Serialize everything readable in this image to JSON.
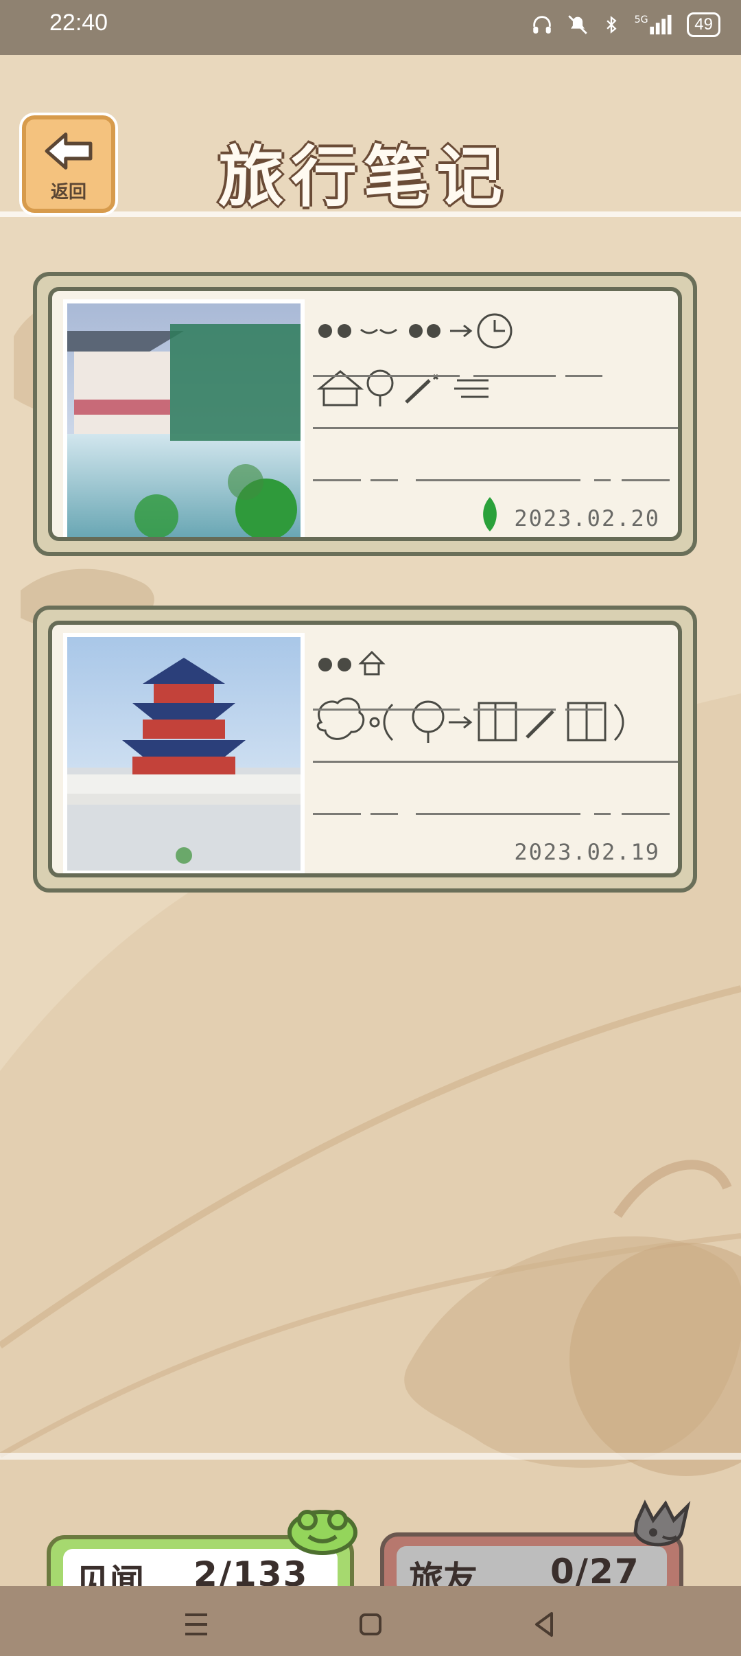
{
  "status_bar": {
    "time": "22:40",
    "battery": "49",
    "icons": [
      "headphones-icon",
      "mute-icon",
      "bluetooth-icon",
      "5g-signal-icon",
      "battery-icon"
    ]
  },
  "header": {
    "title": "旅行笔记",
    "back_label": "返回"
  },
  "cards": [
    {
      "date": "2023.02.20",
      "photo_desc": "pavilion-pond-rain"
    },
    {
      "date": "2023.02.19",
      "photo_desc": "temple-of-heaven"
    }
  ],
  "footer": {
    "sightings_label": "见闻",
    "sightings_value": "2/133",
    "friends_label": "旅友",
    "friends_value": "0/27"
  },
  "colors": {
    "background": "#e9d8bd",
    "accent_green": "#a6d96f",
    "accent_brown": "#6a4b36"
  }
}
